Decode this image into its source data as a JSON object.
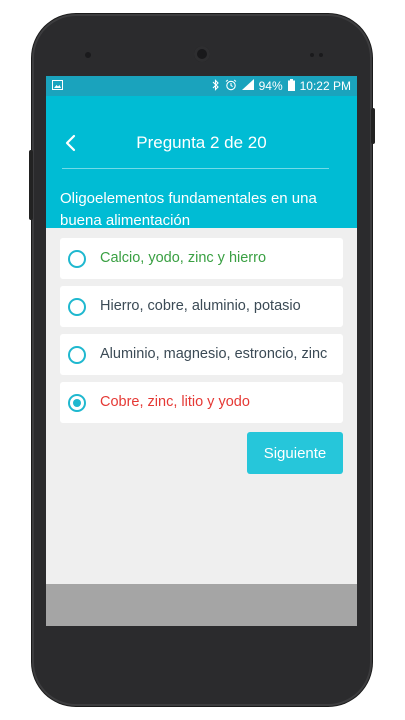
{
  "status_bar": {
    "battery": "94%",
    "time": "10:22 PM"
  },
  "header": {
    "title": "Pregunta 2 de 20",
    "question": "Oligoelementos fundamentales en una buena alimentación"
  },
  "options": [
    {
      "label": "Calcio, yodo, zinc y hierro",
      "state": "correct",
      "color": "#3aa043",
      "selected": false
    },
    {
      "label": "Hierro, cobre, aluminio, potasio",
      "state": "neutral",
      "color": "#3b4a55",
      "selected": false
    },
    {
      "label": "Aluminio, magnesio, estroncio, zinc",
      "state": "neutral",
      "color": "#3b4a55",
      "selected": false
    },
    {
      "label": "Cobre, zinc, litio y yodo",
      "state": "incorrect",
      "color": "#e53935",
      "selected": true
    }
  ],
  "next_button": {
    "label": "Siguiente"
  },
  "colors": {
    "accent": "#00bcd4",
    "status_bar": "#1aa3bd",
    "button": "#26c6da"
  }
}
